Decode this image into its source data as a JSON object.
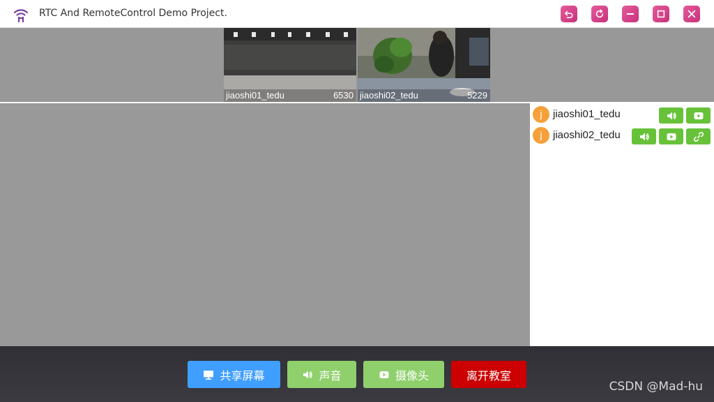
{
  "window": {
    "title": "RTC And RemoteControl Demo Project.",
    "logo_icon": "wifi-signal-icon",
    "accent_color": "#d44a8c"
  },
  "videos": [
    {
      "name": "jiaoshi01_tedu",
      "count": "6530"
    },
    {
      "name": "jiaoshi02_tedu",
      "count": "5229"
    }
  ],
  "users": [
    {
      "avatar": "j",
      "name": "jiaoshi01_tedu",
      "controls": [
        "audio",
        "camera"
      ]
    },
    {
      "avatar": "j",
      "name": "jiaoshi02_tedu",
      "controls": [
        "audio",
        "camera",
        "link"
      ]
    }
  ],
  "toolbar": {
    "share": "共享屏幕",
    "sound": "声音",
    "camera": "摄像头",
    "leave": "离开教室",
    "colors": {
      "share": "#409eff",
      "sound": "#8fd06c",
      "camera": "#8fd06c",
      "leave": "#cc0000"
    }
  },
  "watermark": "CSDN @Mad-hu"
}
